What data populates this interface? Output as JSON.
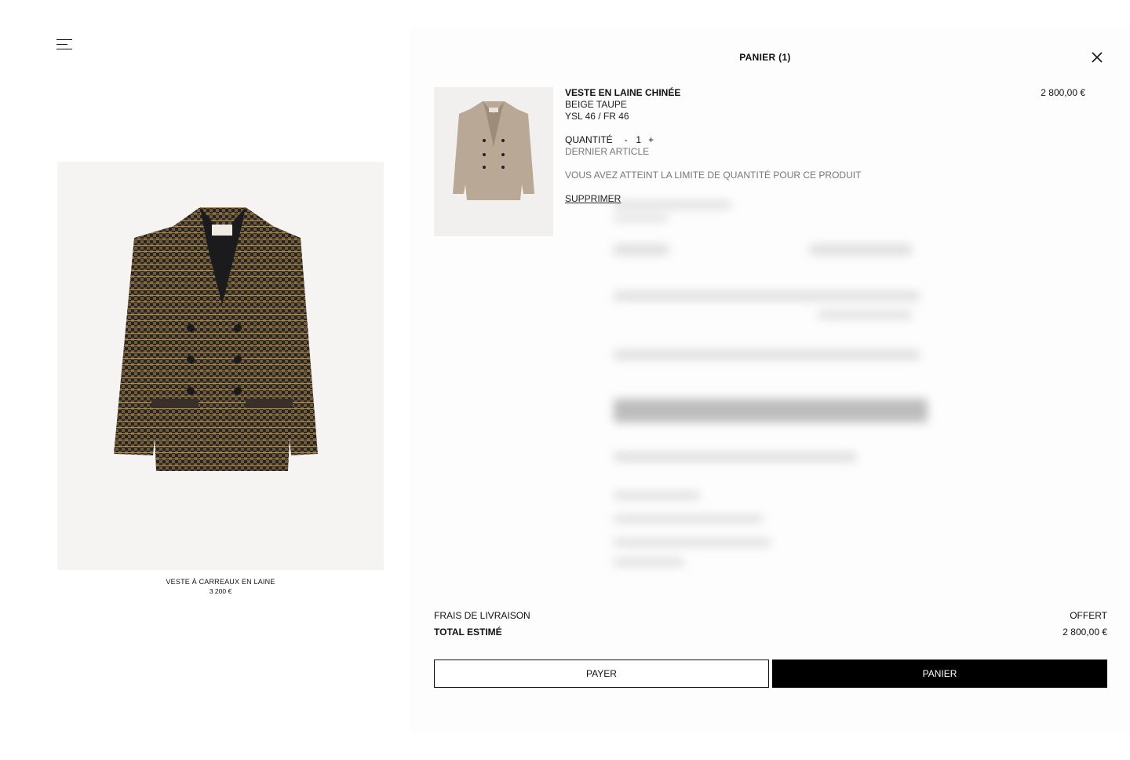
{
  "menu": {
    "icon": "hamburger-menu-icon"
  },
  "product": {
    "name": "VESTE À CARREAUX EN LAINE",
    "price": "3 200 €",
    "image_icon": "houndstooth-blazer-image"
  },
  "cart": {
    "title": "PANIER (1)",
    "close_icon": "close-icon",
    "item": {
      "name": "VESTE EN LAINE CHINÉE",
      "color": "BEIGE TAUPE",
      "size": "YSL 46 / FR 46",
      "quantity_label": "QUANTITÉ",
      "quantity_minus": "-",
      "quantity_value": "1",
      "quantity_plus": "+",
      "stock_status": "DERNIER ARTICLE",
      "limit_message": "VOUS AVEZ ATTEINT LA LIMITE DE QUANTITÉ POUR CE PRODUIT",
      "remove_label": "SUPPRIMER",
      "price": "2 800,00 €"
    },
    "shipping_label": "FRAIS DE LIVRAISON",
    "shipping_value": "OFFERT",
    "total_label": "TOTAL ESTIMÉ",
    "total_value": "2 800,00 €",
    "pay_button": "PAYER",
    "cart_button": "PANIER"
  },
  "colors": {
    "accent": "#000000",
    "panel_bg": "#fdfdfd",
    "image_bg": "#f6f4f2"
  }
}
